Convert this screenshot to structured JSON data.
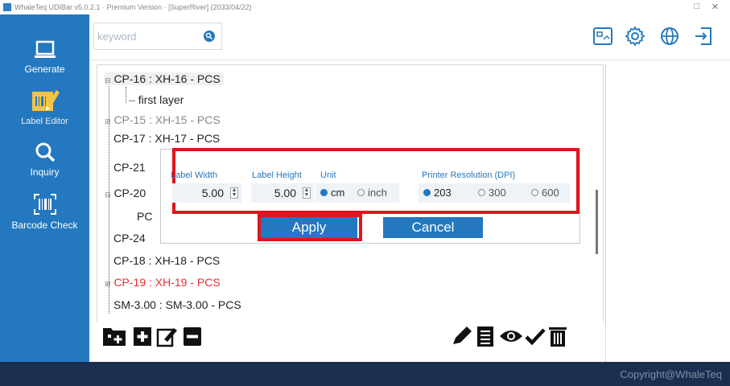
{
  "window": {
    "title": "WhaleTeq UDIBar v5.0.2.1 · Premium Version · [SuperRiver] (2033/04/22)",
    "minimize": "□",
    "close": "✕"
  },
  "sidebar": {
    "items": [
      {
        "label": "Generate",
        "icon": "laptop-icon"
      },
      {
        "label": "Label Editor",
        "icon": "label-editor-icon"
      },
      {
        "label": "Inquiry",
        "icon": "search-icon"
      },
      {
        "label": "Barcode Check",
        "icon": "barcode-icon"
      }
    ]
  },
  "search": {
    "placeholder": "keyword"
  },
  "tree": {
    "rows": [
      {
        "text": "CP-16 : XH-16 - PCS",
        "color": "black"
      },
      {
        "text": "first layer",
        "color": "black"
      },
      {
        "text": "CP-15 : XH-15 - PCS",
        "color": "gray"
      },
      {
        "text": "CP-17 : XH-17 - PCS",
        "color": "black"
      },
      {
        "text": "CP-21",
        "color": "black"
      },
      {
        "text": "CP-20",
        "color": "black"
      },
      {
        "text": "PC",
        "color": "black"
      },
      {
        "text": "CP-24",
        "color": "black"
      },
      {
        "text": "CP-18 : XH-18 - PCS",
        "color": "black"
      },
      {
        "text": "CP-19 : XH-19 - PCS",
        "color": "red"
      },
      {
        "text": "SM-3.00 : SM-3.00 - PCS",
        "color": "black"
      }
    ]
  },
  "dialog": {
    "label_width_title": "Label Width",
    "label_width_value": "5.00",
    "label_height_title": "Label Height",
    "label_height_value": "5.00",
    "unit_title": "Unit",
    "unit_options": [
      "cm",
      "inch"
    ],
    "unit_selected": "cm",
    "dpi_title": "Printer Resolution (DPI)",
    "dpi_options": [
      "203",
      "300",
      "600"
    ],
    "dpi_selected": "203",
    "apply_label": "Apply",
    "cancel_label": "Cancel"
  },
  "footer": {
    "copyright": "Copyright@WhaleTeq"
  },
  "colors": {
    "sidebar": "#2478bf",
    "footer": "#1a2f4f",
    "highlight": "#e0141e",
    "accent": "#2478bf"
  }
}
